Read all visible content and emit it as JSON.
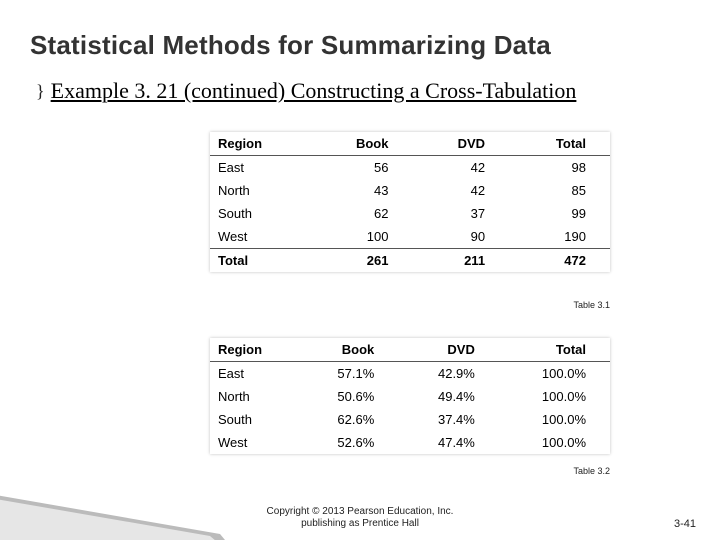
{
  "title": "Statistical Methods for Summarizing Data",
  "bullet_marker": "}",
  "example_text": "Example 3. 21 (continued) Constructing a Cross-Tabulation",
  "chart_data": [
    {
      "type": "table",
      "headers": [
        "Region",
        "Book",
        "DVD",
        "Total"
      ],
      "rows": [
        {
          "region": "East",
          "book": "56",
          "dvd": "42",
          "total": "98"
        },
        {
          "region": "North",
          "book": "43",
          "dvd": "42",
          "total": "85"
        },
        {
          "region": "South",
          "book": "62",
          "dvd": "37",
          "total": "99"
        },
        {
          "region": "West",
          "book": "100",
          "dvd": "90",
          "total": "190"
        }
      ],
      "total_row": {
        "region": "Total",
        "book": "261",
        "dvd": "211",
        "total": "472"
      },
      "caption": "Table 3.1"
    },
    {
      "type": "table",
      "headers": [
        "Region",
        "Book",
        "DVD",
        "Total"
      ],
      "rows": [
        {
          "region": "East",
          "book": "57.1%",
          "dvd": "42.9%",
          "total": "100.0%"
        },
        {
          "region": "North",
          "book": "50.6%",
          "dvd": "49.4%",
          "total": "100.0%"
        },
        {
          "region": "South",
          "book": "62.6%",
          "dvd": "37.4%",
          "total": "100.0%"
        },
        {
          "region": "West",
          "book": "52.6%",
          "dvd": "47.4%",
          "total": "100.0%"
        }
      ],
      "caption": "Table 3.2"
    }
  ],
  "footer": {
    "line1": "Copyright © 2013 Pearson Education, Inc.",
    "line2": "publishing as Prentice Hall",
    "page": "3-41"
  }
}
